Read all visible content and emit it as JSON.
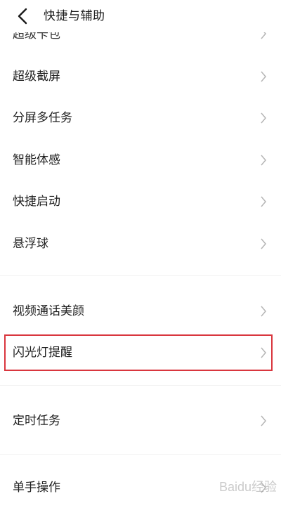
{
  "header": {
    "title": "快捷与辅助"
  },
  "rows": {
    "cut_top": "超级卡包",
    "super_screenshot": "超级截屏",
    "split_multitask": "分屏多任务",
    "smart_motion": "智能体感",
    "quick_launch": "快捷启动",
    "floating_ball": "悬浮球",
    "video_call_beauty": "视频通话美颜",
    "flash_reminder": "闪光灯提醒",
    "timed_task": "定时任务",
    "one_hand": "单手操作"
  },
  "watermark": "Baidu经验",
  "colors": {
    "highlight": "#d9363e",
    "chevron": "#b5b5b5"
  }
}
